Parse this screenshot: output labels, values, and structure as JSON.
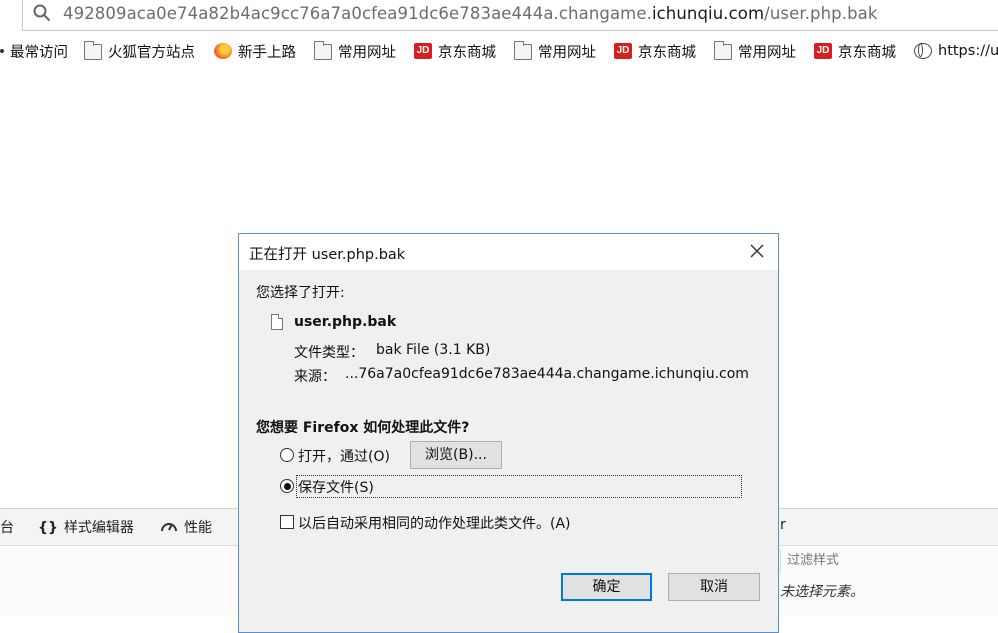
{
  "browser": {
    "url_prefix": "492809aca0e74a82b4ac9cc76a7a0cfea91dc6e783ae444a.changame.",
    "url_domain": "ichunqiu.com",
    "url_path": "/user.php.bak",
    "bookmarks": [
      {
        "label": "最常访问",
        "icon": "dot-icon"
      },
      {
        "label": "火狐官方站点",
        "icon": "folder-icon"
      },
      {
        "label": "新手上路",
        "icon": "firefox-icon"
      },
      {
        "label": "常用网址",
        "icon": "folder-icon"
      },
      {
        "label": "京东商城",
        "icon": "jd-icon"
      },
      {
        "label": "常用网址",
        "icon": "folder-icon"
      },
      {
        "label": "京东商城",
        "icon": "jd-icon"
      },
      {
        "label": "常用网址",
        "icon": "folder-icon"
      },
      {
        "label": "京东商城",
        "icon": "jd-icon"
      },
      {
        "label": "https://u",
        "icon": "globe-icon"
      }
    ],
    "jd_icon_text": "JD"
  },
  "devtools": {
    "tab_console_partial": "台",
    "tab_style_editor": "样式编辑器",
    "tab_style_editor_icon": "{}",
    "tab_performance": "性能",
    "tab_partial_right": "r",
    "filter_placeholder": "过滤样式",
    "no_selection": "未选择元素。"
  },
  "dialog": {
    "title": "正在打开 user.php.bak",
    "you_chose": "您选择了打开:",
    "filename": "user.php.bak",
    "type_label": "文件类型：",
    "type_value": "bak File (3.1 KB)",
    "source_label": "来源：",
    "source_value": "...76a7a0cfea91dc6e783ae444a.changame.ichunqiu.com",
    "question": "您想要 Firefox 如何处理此文件?",
    "open_with_label": "打开，通过(O)",
    "browse_button": "浏览(B)...",
    "save_file_label": "保存文件(S)",
    "auto_label": "以后自动采用相同的动作处理此类文件。(A)",
    "ok_button": "确定",
    "cancel_button": "取消",
    "selected_option": "save"
  },
  "colors": {
    "dialog_border": "#5a8fd6",
    "default_button_border": "#0078d7",
    "jd_red": "#d81e1e"
  }
}
